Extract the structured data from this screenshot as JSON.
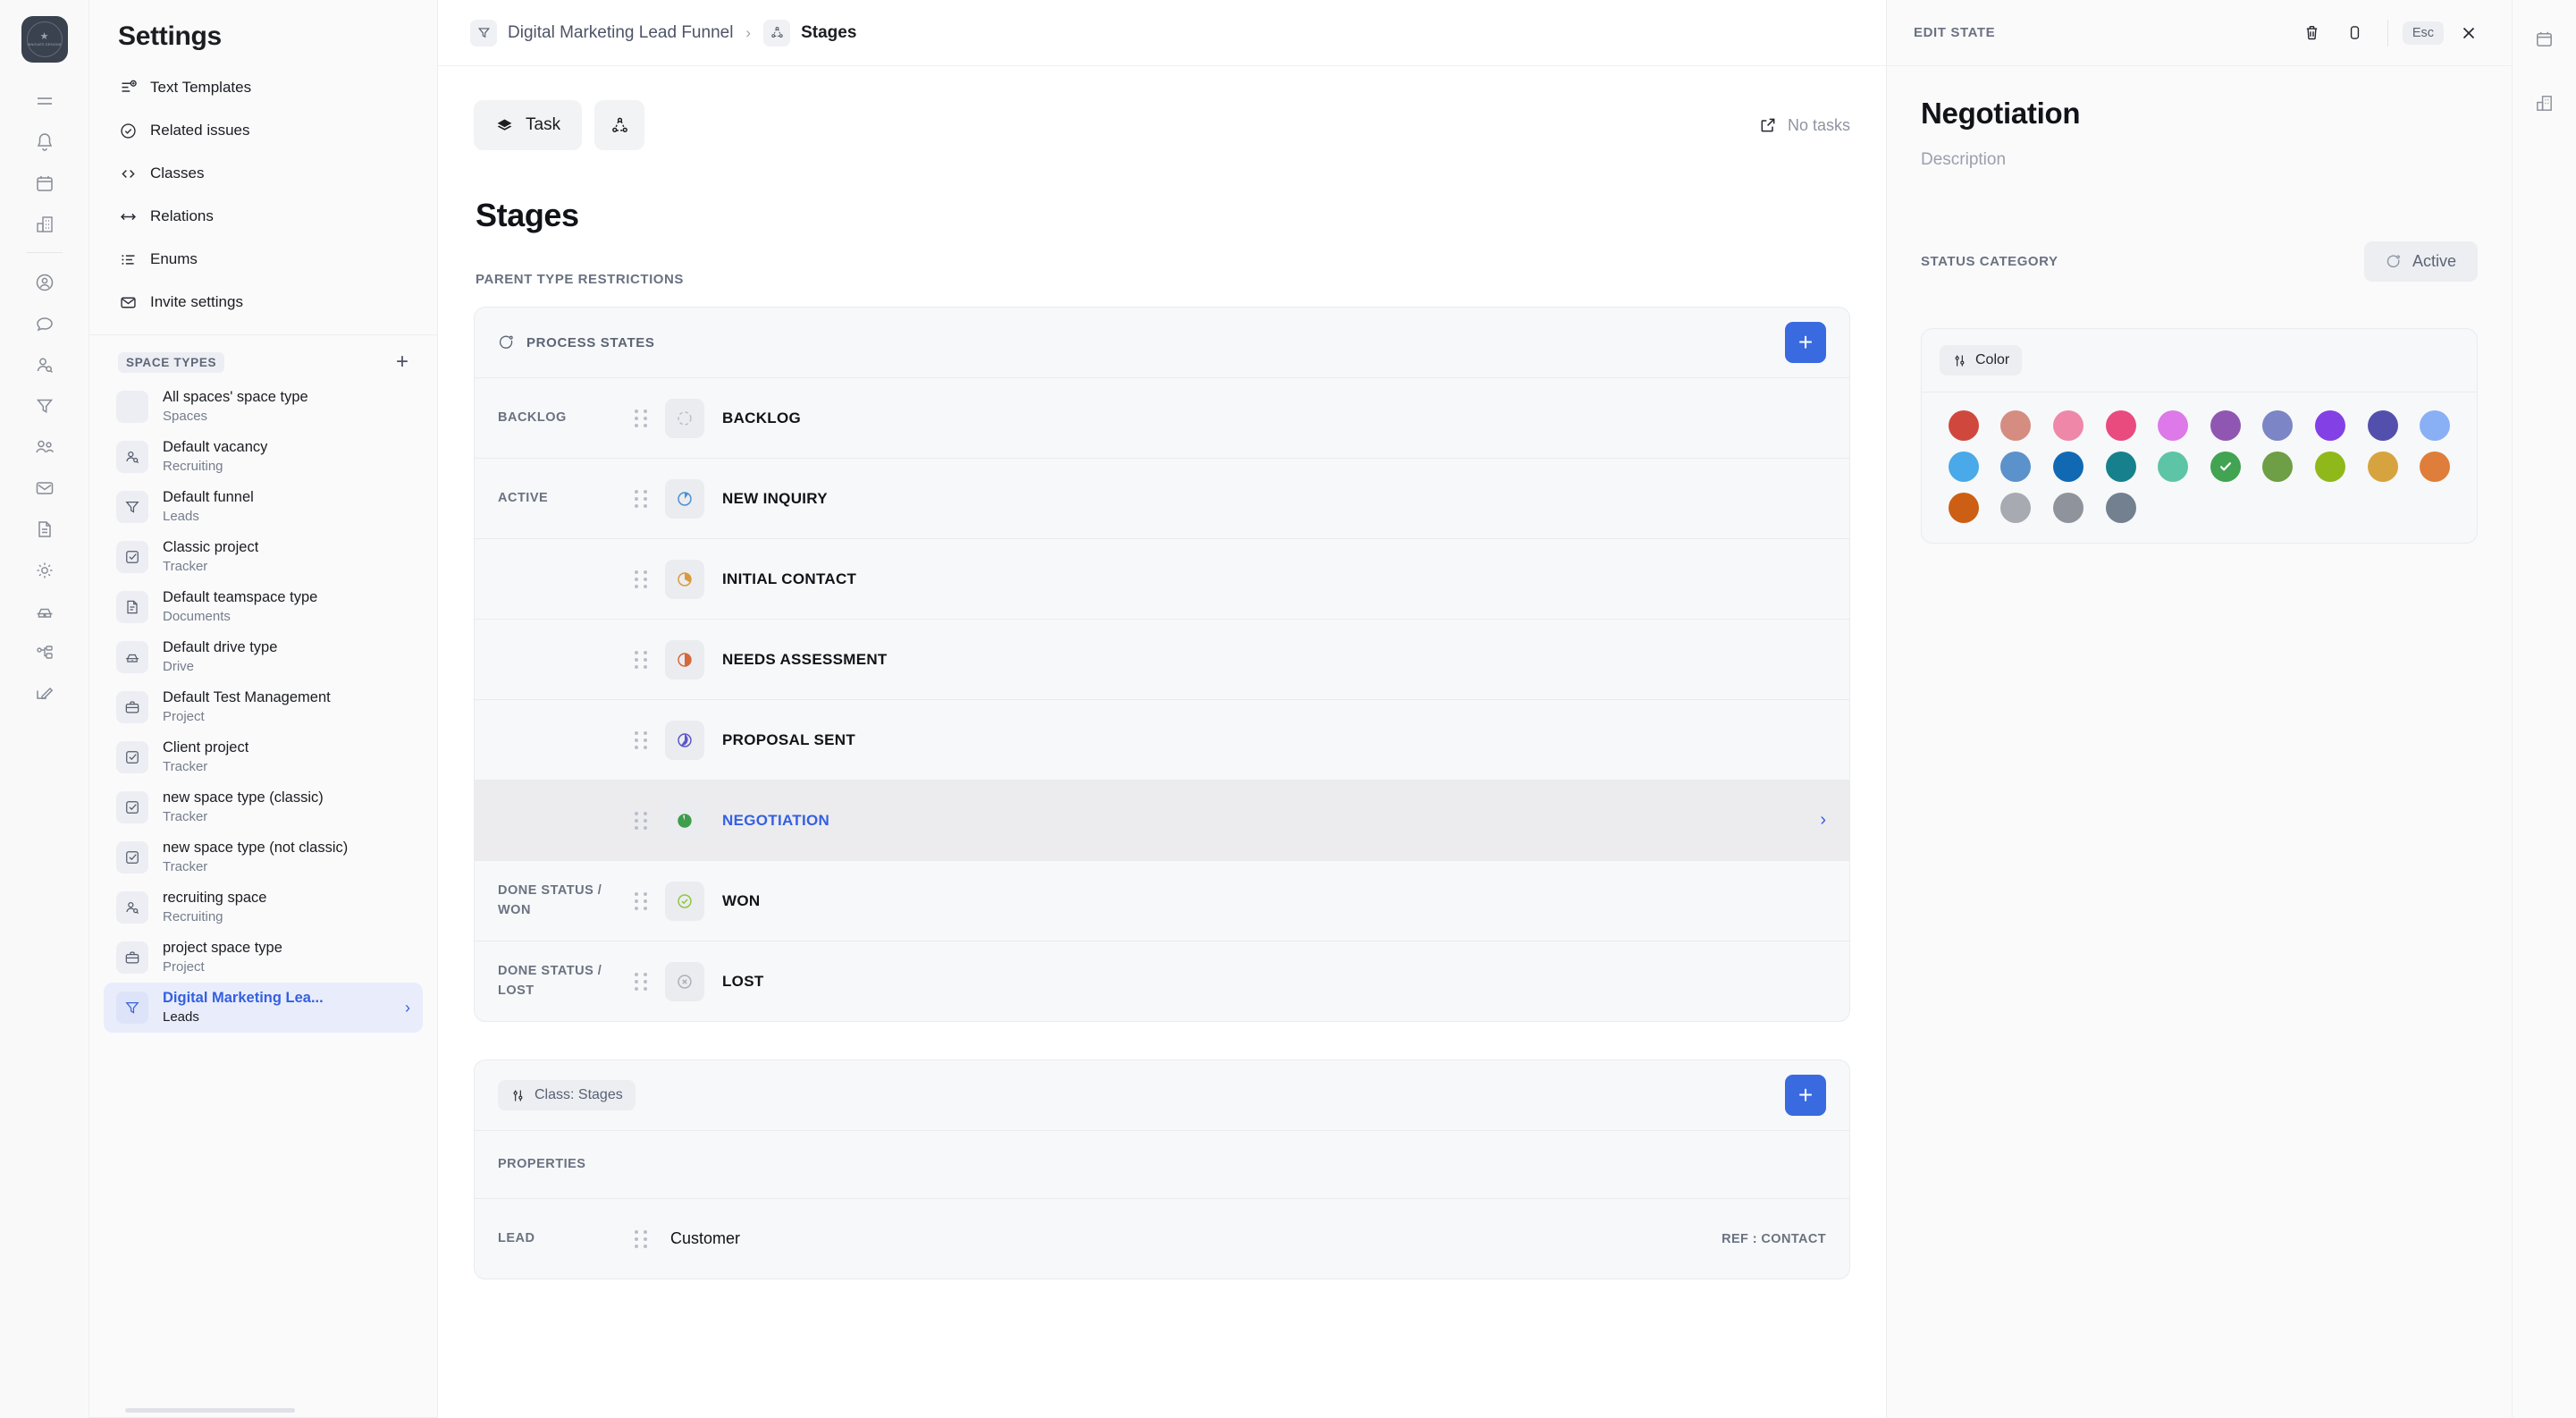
{
  "rail": {
    "logo": {
      "star": "★",
      "label": "INNOVATE DESIGNS",
      "sub": "workspace"
    },
    "items": [
      {
        "name": "menu-icon"
      },
      {
        "name": "notifications-icon"
      },
      {
        "name": "calendar-icon"
      },
      {
        "name": "office-icon"
      },
      {
        "name": "contacts-icon"
      },
      {
        "name": "chat-icon"
      },
      {
        "name": "recruiting-icon"
      },
      {
        "name": "funnel-icon"
      },
      {
        "name": "team-icon"
      },
      {
        "name": "inbox-icon"
      },
      {
        "name": "documents-icon"
      },
      {
        "name": "settings-sun-icon"
      },
      {
        "name": "drive-icon"
      },
      {
        "name": "process-icon"
      },
      {
        "name": "edit-icon"
      }
    ]
  },
  "sidebar": {
    "title": "Settings",
    "nav": [
      {
        "label": "Text Templates",
        "icon": "text-template-icon"
      },
      {
        "label": "Related issues",
        "icon": "check-circle-icon"
      },
      {
        "label": "Classes",
        "icon": "code-icon"
      },
      {
        "label": "Relations",
        "icon": "arrows-icon"
      },
      {
        "label": "Enums",
        "icon": "list-icon"
      },
      {
        "label": "Invite settings",
        "icon": "envelope-icon"
      }
    ],
    "section_title": "SPACE TYPES",
    "add_label": "+",
    "spaces": [
      {
        "name": "All spaces' space type",
        "sub": "Spaces",
        "icon": "blank-icon",
        "active": false
      },
      {
        "name": "Default vacancy",
        "sub": "Recruiting",
        "icon": "recruiting-icon",
        "active": false
      },
      {
        "name": "Default funnel",
        "sub": "Leads",
        "icon": "funnel-icon",
        "active": false
      },
      {
        "name": "Classic project",
        "sub": "Tracker",
        "icon": "checkbox-icon",
        "active": false
      },
      {
        "name": "Default teamspace type",
        "sub": "Documents",
        "icon": "document-icon",
        "active": false
      },
      {
        "name": "Default drive type",
        "sub": "Drive",
        "icon": "drive-icon",
        "active": false
      },
      {
        "name": "Default Test Management",
        "sub": "Project",
        "icon": "briefcase-icon",
        "active": false
      },
      {
        "name": "Client project",
        "sub": "Tracker",
        "icon": "checkbox-icon",
        "active": false
      },
      {
        "name": "new space type (classic)",
        "sub": "Tracker",
        "icon": "checkbox-icon",
        "active": false
      },
      {
        "name": "new space type (not classic)",
        "sub": "Tracker",
        "icon": "checkbox-icon",
        "active": false
      },
      {
        "name": "recruiting space",
        "sub": "Recruiting",
        "icon": "recruiting-icon",
        "active": false
      },
      {
        "name": "project space type",
        "sub": "Project",
        "icon": "briefcase-icon",
        "active": false
      },
      {
        "name": "Digital Marketing Lea...",
        "sub": "Leads",
        "icon": "funnel-icon",
        "active": true
      }
    ]
  },
  "breadcrumb": {
    "parent": "Digital Marketing Lead Funnel",
    "separator": "›",
    "current": "Stages"
  },
  "main": {
    "tabs": [
      {
        "label": "Task",
        "icon": "layers-icon"
      },
      {
        "label": "",
        "icon": "process-icon"
      }
    ],
    "no_tasks": "No tasks",
    "page_title": "Stages",
    "parent_type_restrictions": "PARENT TYPE RESTRICTIONS",
    "process_card": {
      "title": "PROCESS STATES",
      "add_label": "+",
      "rows": [
        {
          "category": "BACKLOG",
          "name": "BACKLOG",
          "color": "#b9bec8",
          "fill": 0,
          "selected": false
        },
        {
          "category": "ACTIVE",
          "name": "NEW INQUIRY",
          "color": "#4a8fd6",
          "fill": 15,
          "selected": false
        },
        {
          "category": "",
          "name": "INITIAL CONTACT",
          "color": "#d99a3c",
          "fill": 30,
          "selected": false
        },
        {
          "category": "",
          "name": "NEEDS ASSESSMENT",
          "color": "#d4693a",
          "fill": 50,
          "selected": false
        },
        {
          "category": "",
          "name": "PROPOSAL SENT",
          "color": "#5b55c9",
          "fill": 65,
          "selected": false
        },
        {
          "category": "",
          "name": "NEGOTIATION",
          "color": "#3e9e4b",
          "fill": 90,
          "selected": true
        },
        {
          "category": "DONE STATUS / WON",
          "name": "WON",
          "color": "#8cc63f",
          "fill": -1,
          "selected": false
        },
        {
          "category": "DONE STATUS / LOST",
          "name": "LOST",
          "color": "#b9bec8",
          "fill": -2,
          "selected": false
        }
      ]
    },
    "class_card": {
      "chip_label": "Class: Stages",
      "add_label": "+",
      "properties_label": "PROPERTIES",
      "rows": [
        {
          "category": "LEAD",
          "name": "Customer",
          "ref": "REF : CONTACT"
        }
      ]
    }
  },
  "panel": {
    "header_label": "EDIT STATE",
    "esc_label": "Esc",
    "actions": [
      {
        "name": "delete-icon"
      },
      {
        "name": "duplicate-icon"
      },
      {
        "name": "close-icon"
      }
    ],
    "state_name": "Negotiation",
    "description_placeholder": "Description",
    "status_category_label": "STATUS CATEGORY",
    "status_category_value": "Active",
    "color_section": {
      "chip_label": "Color",
      "selected_index": 15,
      "swatches": [
        "#d0483d",
        "#d48d80",
        "#ef87a9",
        "#e94b7e",
        "#dd79e8",
        "#9057b2",
        "#7c85c5",
        "#8240e5",
        "#5350ad",
        "#89b0f5",
        "#4aa9e8",
        "#5b92cc",
        "#1169b3",
        "#16818c",
        "#5ec4a6",
        "#42a352",
        "#6e9e45",
        "#8fb81b",
        "#d7a33e",
        "#df7e3a",
        "#cc5f14",
        "#a7aab0",
        "#8f949c",
        "#72808f"
      ]
    }
  },
  "right_rail": {
    "items": [
      {
        "name": "calendar-icon"
      },
      {
        "name": "office-icon"
      }
    ]
  }
}
